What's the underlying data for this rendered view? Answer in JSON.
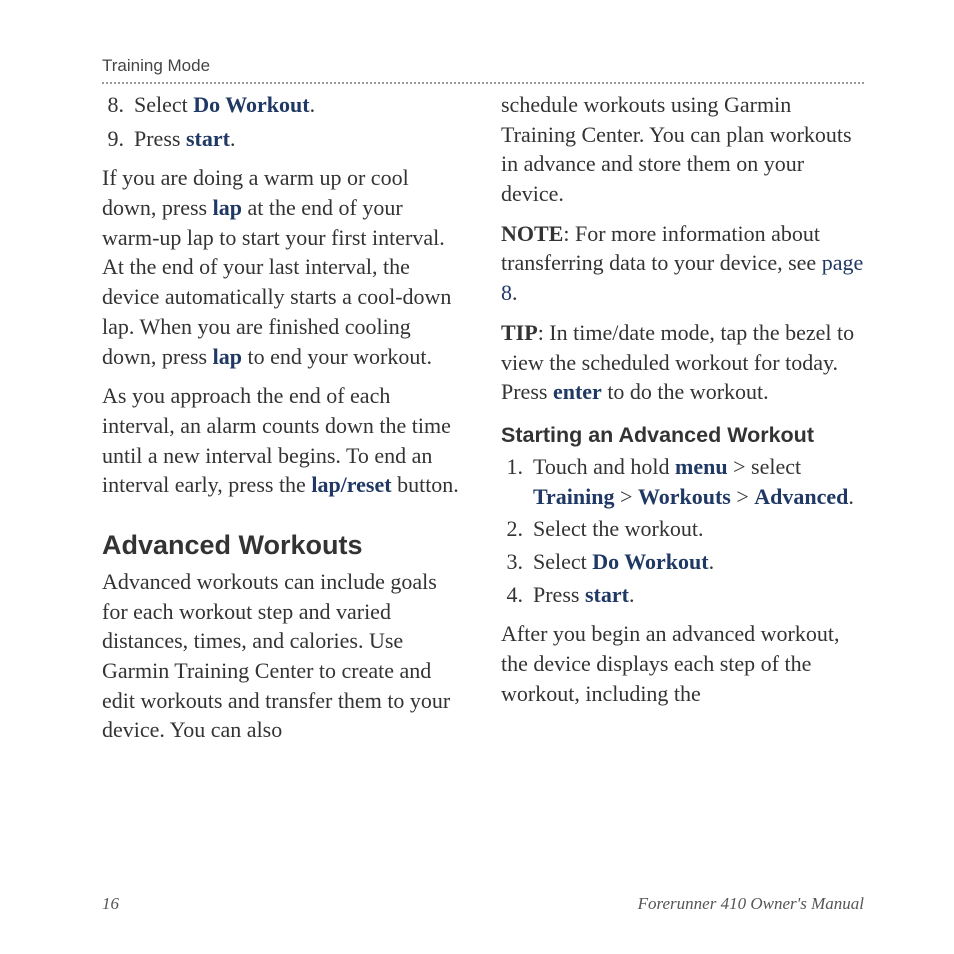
{
  "header": {
    "section": "Training Mode"
  },
  "col1": {
    "list1": {
      "n8": "8.",
      "i8a": "Select ",
      "i8b": "Do Workout",
      "i8c": ".",
      "n9": "9.",
      "i9a": "Press ",
      "i9b": "start",
      "i9c": "."
    },
    "p1": {
      "a": "If you are doing a warm up or cool down, press ",
      "b": "lap",
      "c": " at the end of your warm-up lap to start your first interval. At the end of your last interval, the device automatically starts a cool-down lap. When you are finished cooling down, press ",
      "d": "lap",
      "e": " to end your workout."
    },
    "p2": {
      "a": "As you approach the end of each interval, an alarm counts down the time until a new interval begins. To end an interval early, press the ",
      "b": "lap/reset",
      "c": " button."
    },
    "h2": "Advanced Workouts",
    "p3": "Advanced workouts can include goals for each workout step and varied distances, times, and calories. Use Garmin Training Center to create and edit workouts and transfer them to your device. You can also"
  },
  "col2": {
    "p1": "schedule workouts using Garmin Training Center. You can plan workouts in advance and store them on your device.",
    "p2": {
      "a": "NOTE",
      "b": ": For more information about transferring data to your device, see ",
      "c": "page 8",
      "d": "."
    },
    "p3": {
      "a": "TIP",
      "b": ": In time/date mode, tap the bezel to view the scheduled workout for today. Press ",
      "c": "enter",
      "d": " to do the workout."
    },
    "h3": "Starting an Advanced Workout",
    "list2": {
      "n1": "1.",
      "i1a": "Touch and hold ",
      "i1b": "menu",
      "i1c": " > select ",
      "i1d": "Training",
      "i1e": " > ",
      "i1f": "Workouts",
      "i1g": " > ",
      "i1h": "Advanced",
      "i1i": ".",
      "n2": "2.",
      "i2": "Select the workout.",
      "n3": "3.",
      "i3a": "Select ",
      "i3b": "Do Workout",
      "i3c": ".",
      "n4": "4.",
      "i4a": "Press ",
      "i4b": "start",
      "i4c": "."
    },
    "p4": "After you begin an advanced workout, the device displays each step of the workout, including the"
  },
  "footer": {
    "page": "16",
    "title": "Forerunner 410 Owner's Manual"
  }
}
